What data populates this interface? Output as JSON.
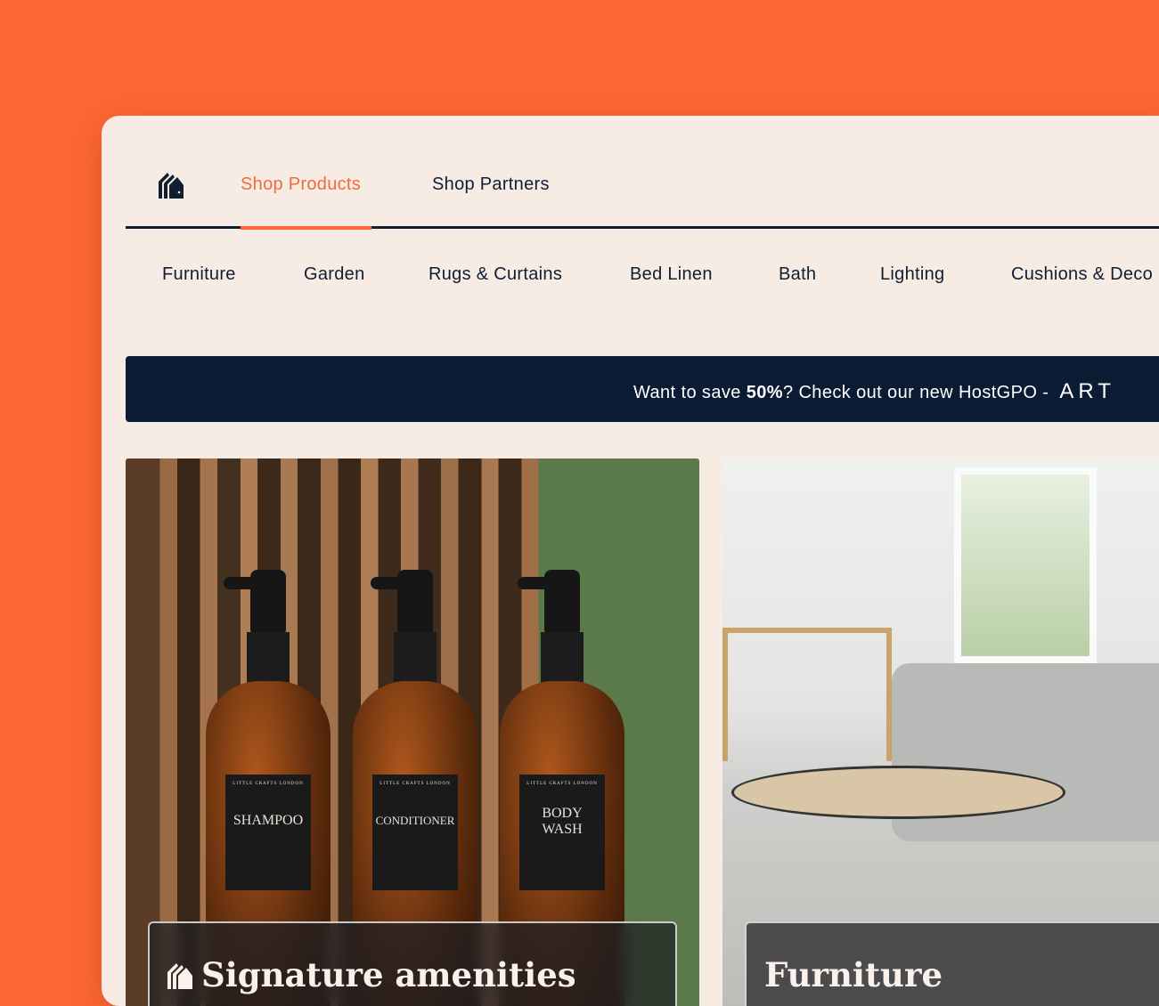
{
  "nav": {
    "tabs": [
      {
        "label": "Shop Products",
        "active": true
      },
      {
        "label": "Shop Partners",
        "active": false
      }
    ]
  },
  "categories": [
    "Furniture",
    "Garden",
    "Rugs & Curtains",
    "Bed Linen",
    "Bath",
    "Lighting",
    "Cushions & Deco"
  ],
  "banner": {
    "prefix": "Want to save ",
    "highlight": "50%",
    "suffix": "? Check out our new HostGPO - ",
    "brand": "ART"
  },
  "cards": [
    {
      "title": "Signature amenities",
      "bottles": [
        {
          "maker": "LITTLE CRAFTS LONDON",
          "name": "SHAMPOO"
        },
        {
          "maker": "LITTLE CRAFTS LONDON",
          "name": "CONDITIONER"
        },
        {
          "maker": "LITTLE CRAFTS LONDON",
          "name": "BODY WASH"
        }
      ]
    },
    {
      "title": "Furniture"
    }
  ],
  "colors": {
    "background": "#FE6633",
    "accent": "#F26A3A",
    "navy": "#0B1B33",
    "page": "#F7ECE4"
  },
  "icons": {
    "logo": "house-stripes-icon"
  }
}
